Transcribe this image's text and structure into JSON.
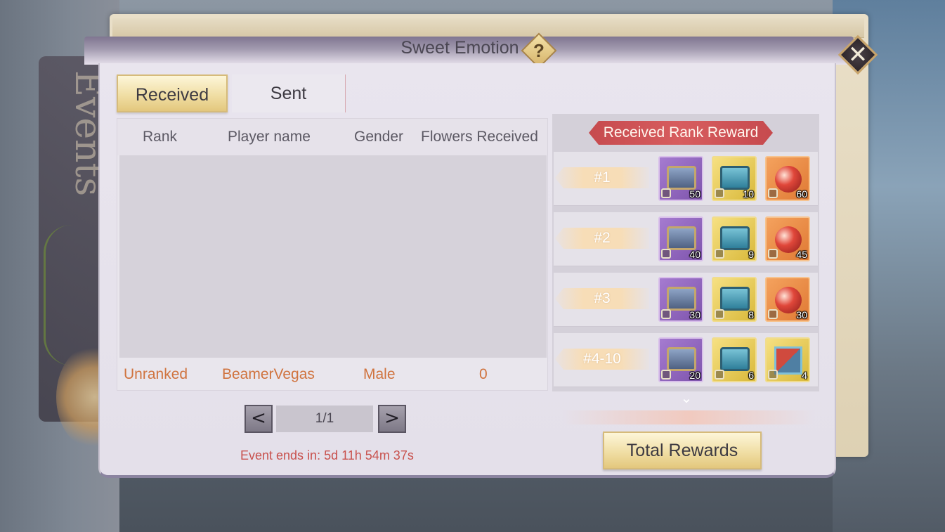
{
  "window": {
    "title": "Sweet Emotion",
    "help_symbol": "?",
    "close_symbol": "✕"
  },
  "background": {
    "banner_text": "Events"
  },
  "tabs": [
    {
      "label": "Received",
      "active": true
    },
    {
      "label": "Sent",
      "active": false
    }
  ],
  "leaderboard": {
    "columns": [
      "Rank",
      "Player name",
      "Gender",
      "Flowers Received"
    ],
    "rows": [],
    "self_row": {
      "rank": "Unranked",
      "player_name": "BeamerVegas",
      "gender": "Male",
      "flowers_received": "0"
    },
    "self_row_color": "#d0733e"
  },
  "pager": {
    "prev_symbol": "<",
    "next_symbol": ">",
    "page_display": "1/1"
  },
  "event_ends": "Event ends in: 5d 11h 54m 37s",
  "rewards": {
    "header": "Received Rank Reward",
    "rows": [
      {
        "rank": "#1",
        "items": [
          {
            "icon": "purple-chest-icon",
            "qty": "50"
          },
          {
            "icon": "blue-chest-icon",
            "qty": "10"
          },
          {
            "icon": "red-orb-icon",
            "qty": "60"
          }
        ]
      },
      {
        "rank": "#2",
        "items": [
          {
            "icon": "purple-chest-icon",
            "qty": "40"
          },
          {
            "icon": "blue-chest-icon",
            "qty": "9"
          },
          {
            "icon": "red-orb-icon",
            "qty": "45"
          }
        ]
      },
      {
        "rank": "#3",
        "items": [
          {
            "icon": "purple-chest-icon",
            "qty": "30"
          },
          {
            "icon": "blue-chest-icon",
            "qty": "8"
          },
          {
            "icon": "red-orb-icon",
            "qty": "30"
          }
        ]
      },
      {
        "rank": "#4-10",
        "items": [
          {
            "icon": "purple-chest-icon",
            "qty": "20"
          },
          {
            "icon": "blue-chest-icon",
            "qty": "6"
          },
          {
            "icon": "gift-cube-icon",
            "qty": "4"
          }
        ]
      }
    ],
    "scroll_down_symbol": "⌄",
    "total_button": "Total Rewards"
  },
  "colors": {
    "accent_gold": "#efdca0",
    "reward_header_red": "#c64a4e",
    "countdown_red": "#c8514d"
  }
}
